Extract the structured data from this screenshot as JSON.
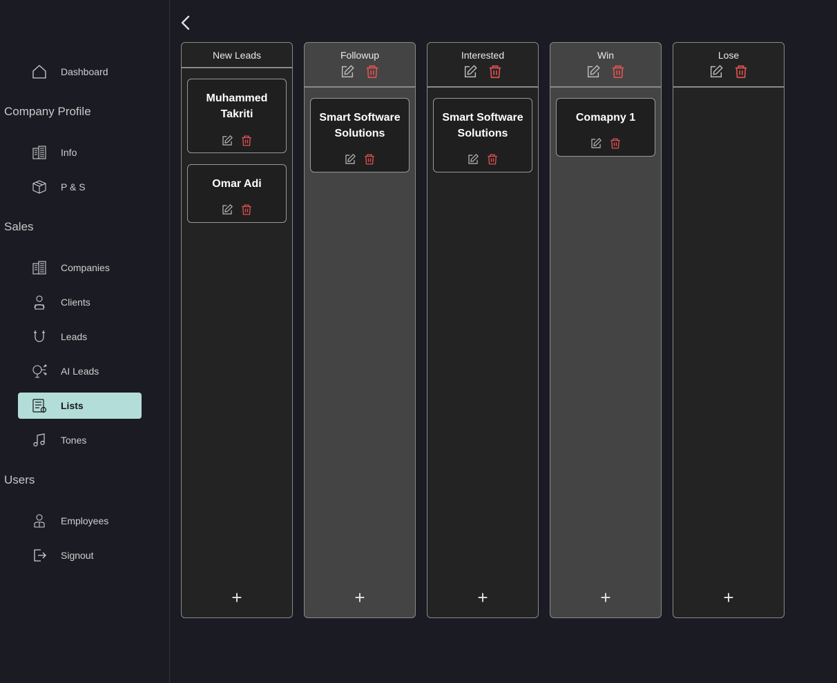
{
  "sidebar": {
    "items": [
      {
        "id": "dashboard",
        "label": "Dashboard",
        "icon": "home-icon"
      },
      {
        "id": "info",
        "label": "Info",
        "icon": "buildings-icon"
      },
      {
        "id": "ps",
        "label": "P & S",
        "icon": "box-icon"
      },
      {
        "id": "companies",
        "label": "Companies",
        "icon": "buildings-icon"
      },
      {
        "id": "clients",
        "label": "Clients",
        "icon": "client-icon"
      },
      {
        "id": "leads",
        "label": "Leads",
        "icon": "magnet-icon"
      },
      {
        "id": "ai_leads",
        "label": "AI Leads",
        "icon": "ai-brain-icon"
      },
      {
        "id": "lists",
        "label": "Lists",
        "icon": "list-icon",
        "active": true
      },
      {
        "id": "tones",
        "label": "Tones",
        "icon": "music-note-icon"
      },
      {
        "id": "employees",
        "label": "Employees",
        "icon": "employee-icon"
      },
      {
        "id": "signout",
        "label": "Signout",
        "icon": "signout-icon"
      }
    ],
    "sections": {
      "company_profile": "Company Profile",
      "sales": "Sales",
      "users": "Users"
    }
  },
  "board": {
    "columns": [
      {
        "title": "New Leads",
        "cards": [
          "Muhammed Takriti",
          "Omar Adi"
        ]
      },
      {
        "title": "Followup",
        "cards": [
          "Smart Software Solutions"
        ]
      },
      {
        "title": "Interested",
        "cards": [
          "Smart Software Solutions"
        ]
      },
      {
        "title": "Win",
        "cards": [
          "Comapny 1"
        ]
      },
      {
        "title": "Lose",
        "cards": []
      }
    ],
    "add_label": "+"
  },
  "colors": {
    "background": "#1b1b23",
    "accent": "#b3ddd8",
    "delete": "#e05252",
    "column_dark": "#232323",
    "column_light": "#444444"
  }
}
